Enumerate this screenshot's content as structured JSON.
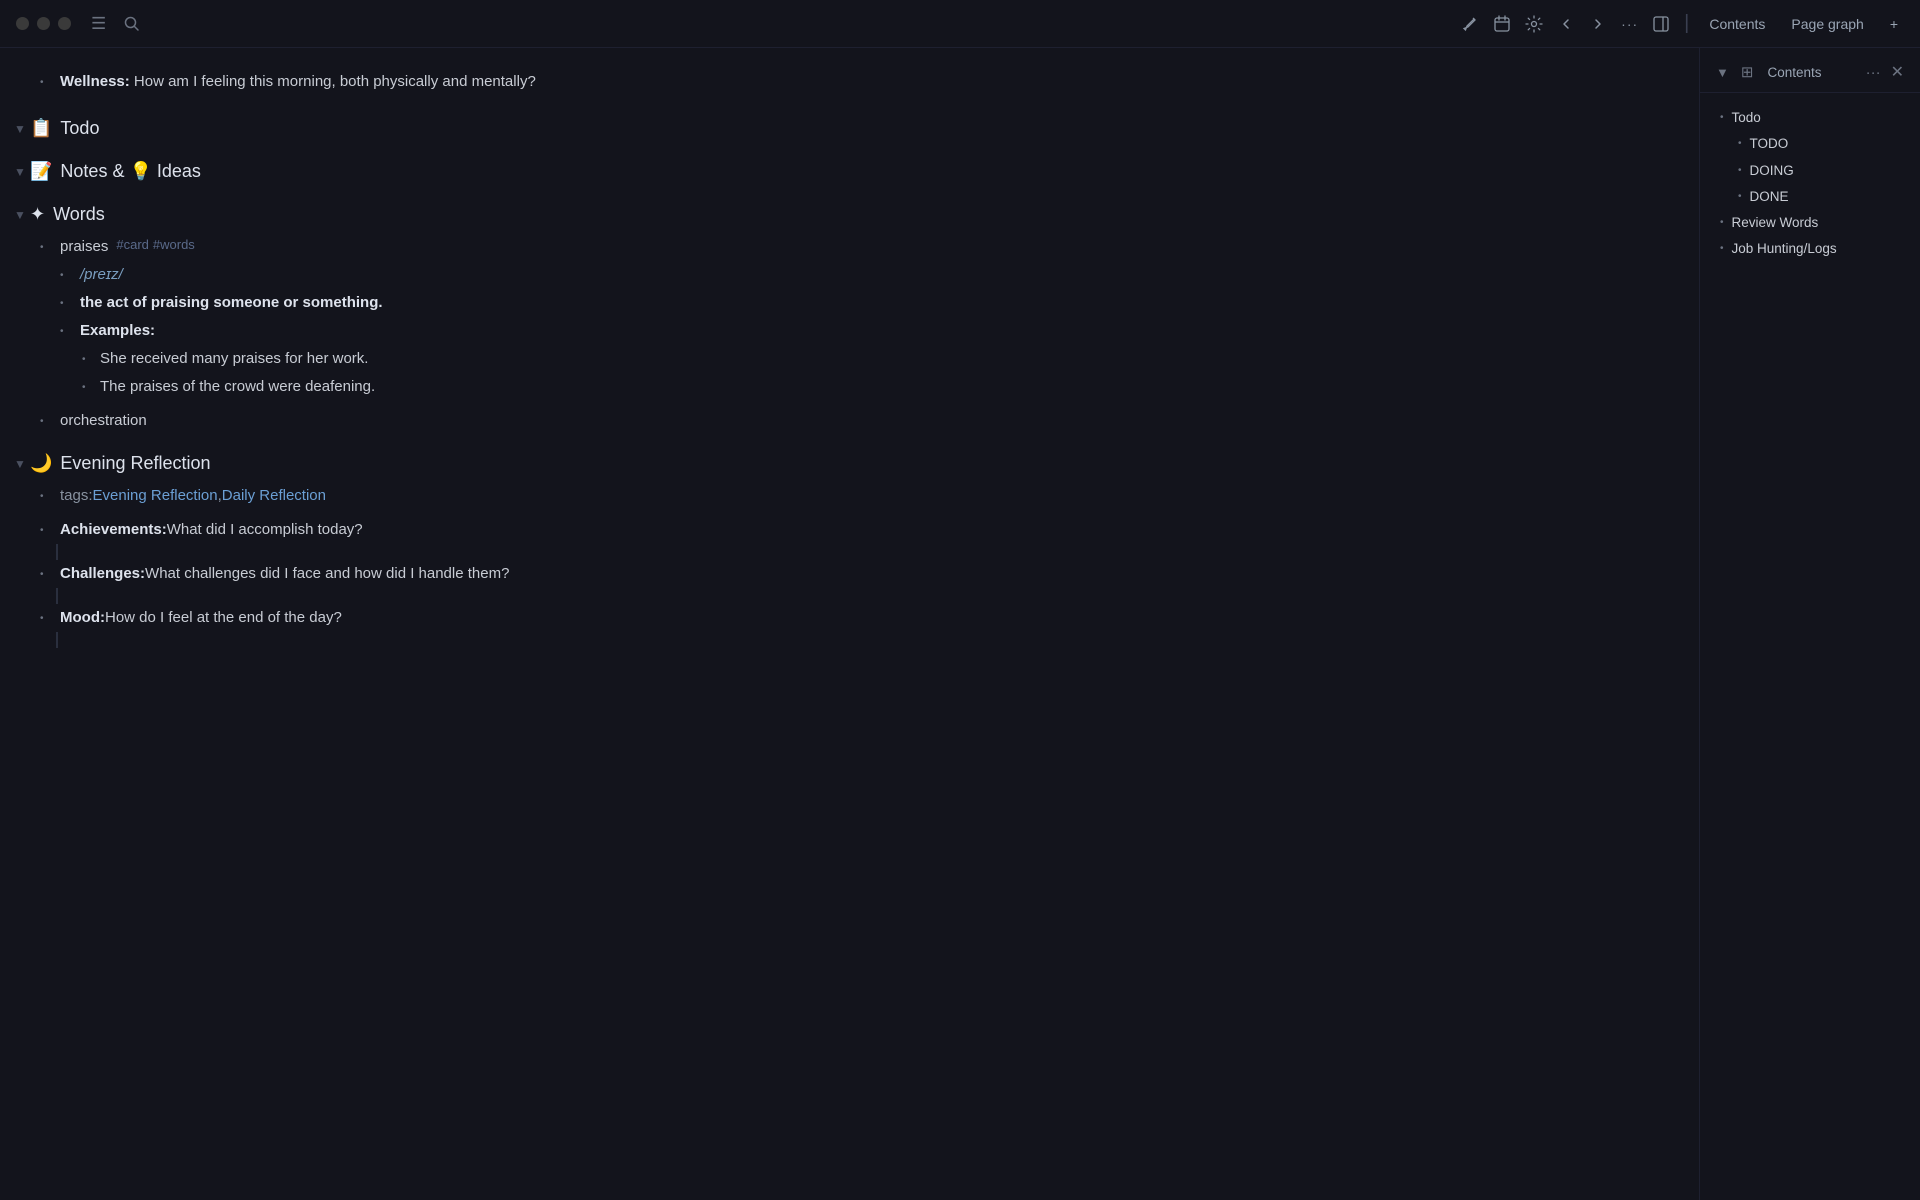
{
  "titlebar": {
    "traffic_lights": [
      "close",
      "minimize",
      "maximize"
    ],
    "icons": {
      "menu": "☰",
      "search": "🔍",
      "edit": "✏",
      "calendar": "📅",
      "settings": "⚙",
      "back": "←",
      "forward": "→",
      "more": "···",
      "panel": "⬜"
    },
    "tabs": [
      {
        "label": "Contents"
      },
      {
        "label": "Page graph"
      }
    ],
    "extra_tab": "+"
  },
  "content": {
    "sections": [
      {
        "id": "wellness-partial",
        "type": "partial",
        "items": [
          {
            "text_bold": "Wellness:",
            "text_plain": " How am I feeling this morning, both physically and mentally?"
          }
        ]
      },
      {
        "id": "todo",
        "icon": "📋",
        "title": "Todo"
      },
      {
        "id": "notes-ideas",
        "icon": "📝",
        "title": "Notes & 💡 Ideas"
      },
      {
        "id": "words",
        "icon": "✦",
        "title": "Words",
        "items": [
          {
            "type": "word-entry",
            "word": "praises",
            "tag_card": "#card",
            "tag_words": "#words",
            "sub_items": [
              {
                "type": "phonetic",
                "text": "/preɪz/"
              },
              {
                "type": "definition",
                "text": "the act of praising someone or something."
              },
              {
                "type": "examples_header",
                "text": "Examples:"
              },
              {
                "type": "example",
                "text": "She received many praises for her work."
              },
              {
                "type": "example",
                "text": "The praises of the crowd were deafening."
              }
            ]
          },
          {
            "type": "plain",
            "text": "orchestration"
          }
        ]
      },
      {
        "id": "evening-reflection",
        "icon": "🌙",
        "title": "Evening Reflection",
        "items": [
          {
            "type": "tags",
            "prefix": "tags: ",
            "links": [
              "Evening Reflection",
              "Daily Reflection"
            ]
          },
          {
            "type": "field",
            "bold": "Achievements:",
            "plain": " What did I accomplish today?"
          },
          {
            "type": "field",
            "bold": "Challenges:",
            "plain": " What challenges did I face and how did I handle them?"
          },
          {
            "type": "field",
            "bold": "Mood:",
            "plain": " How do I feel at the end of the day?"
          }
        ]
      }
    ]
  },
  "sidebar": {
    "title": "Contents",
    "title_icon": "⊞",
    "items": [
      {
        "id": "todo",
        "label": "Todo",
        "level": 0
      },
      {
        "id": "todo-todo",
        "label": "TODO",
        "level": 1
      },
      {
        "id": "todo-doing",
        "label": "DOING",
        "level": 1
      },
      {
        "id": "todo-done",
        "label": "DONE",
        "level": 1
      },
      {
        "id": "review-words",
        "label": "Review Words",
        "level": 0
      },
      {
        "id": "job-hunting",
        "label": "Job Hunting/Logs",
        "level": 0
      }
    ]
  }
}
